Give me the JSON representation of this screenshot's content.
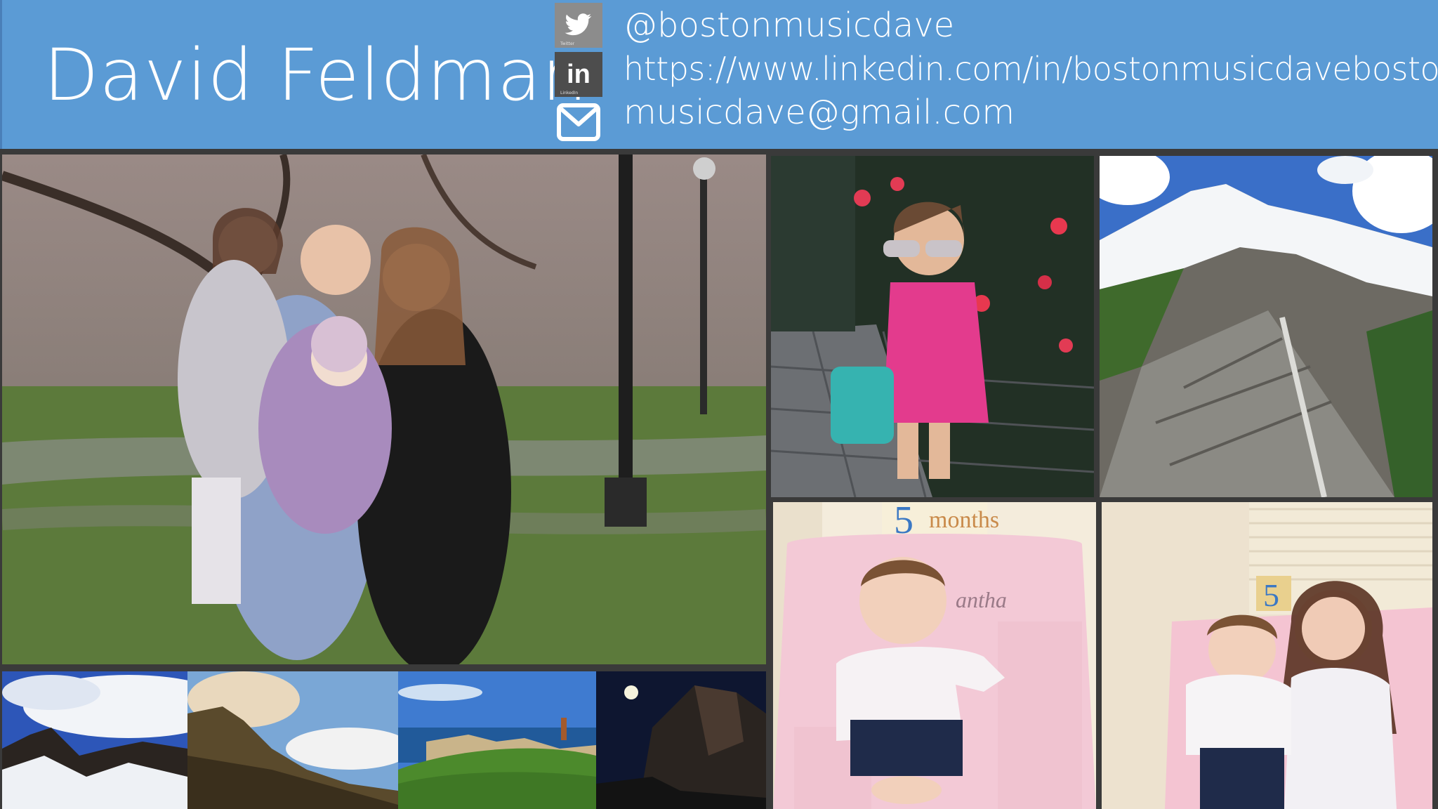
{
  "header": {
    "name": "David Feldman",
    "background": "#5b9bd5",
    "icons": {
      "twitter": "twitter-icon",
      "twitter_caption": "Twitter",
      "linkedin": "linkedin-icon",
      "linkedin_caption": "LinkedIn",
      "linkedin_glyph": "in",
      "mail": "mail-icon"
    },
    "twitter_handle": "@bostonmusicdave",
    "linkedin_url": "https://www.linkedin.com/in/bostonmusicdaveboston",
    "email": "musicdave@gmail.com"
  },
  "photos": {
    "family": "family-photo",
    "toddler_sunglasses": "toddler-photo",
    "mountain": "mountain-photo",
    "baby_chair": "baby-photo",
    "baby_chair_label": "5 months",
    "baby_chair_number": "5",
    "baby_chair_word": "months",
    "baby_chair_name_fragment": "antha",
    "sisters": "sisters-photo",
    "sisters_number": "5",
    "snow_peaks": "snow-peaks-photo",
    "cliffs": "cliffs-photo",
    "lighthouse": "lighthouse-photo",
    "night_moon": "night-moon-photo"
  }
}
